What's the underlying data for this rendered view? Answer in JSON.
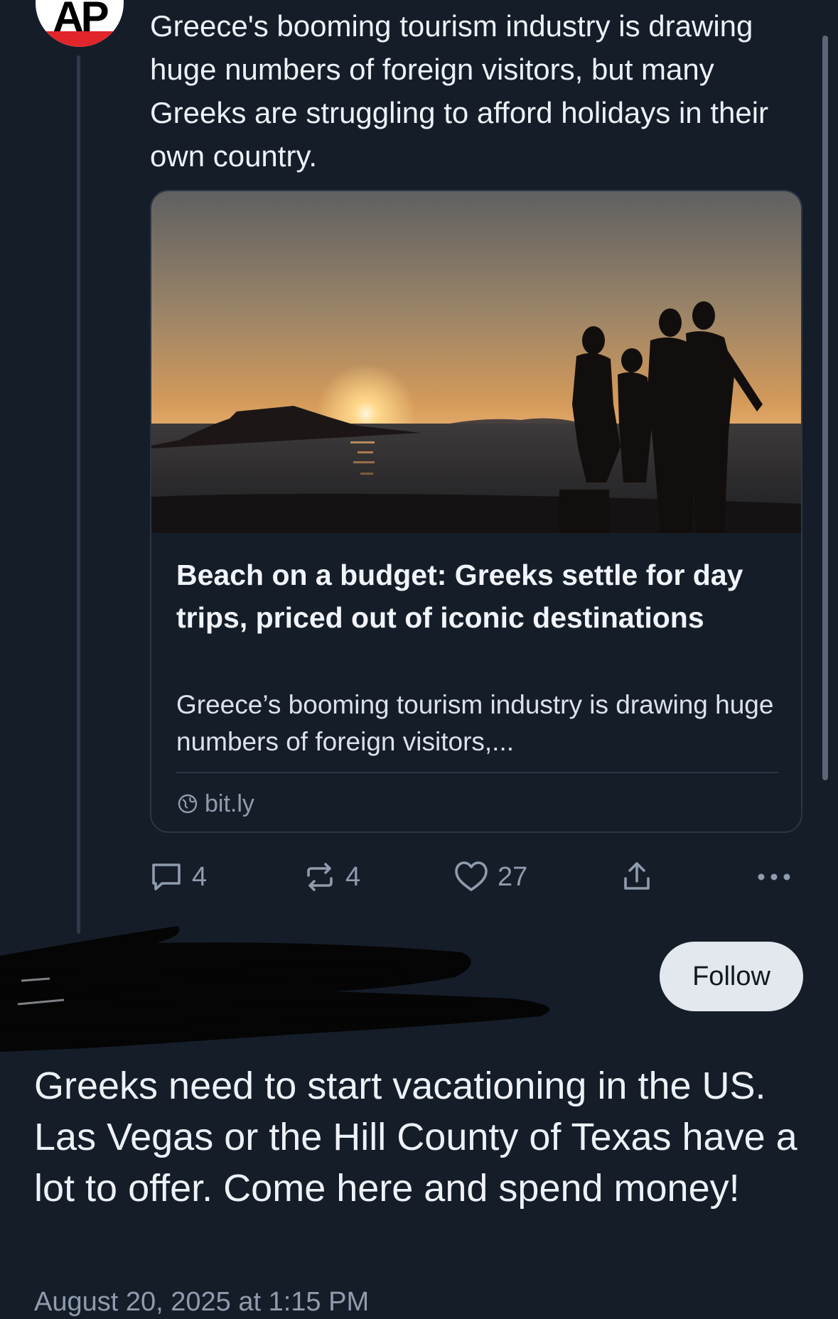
{
  "post": {
    "avatar_label": "AP",
    "text": "Greece's booming tourism industry is drawing huge numbers of foreign visitors, but many Greeks are struggling to afford holidays in their own country.",
    "link_card": {
      "title": "Beach on a budget: Greeks settle for day trips, priced out of iconic destinations",
      "description": "Greece’s booming tourism industry is drawing huge numbers of foreign visitors,...",
      "source": "bit.ly"
    },
    "actions": {
      "replies": "4",
      "reposts": "4",
      "likes": "27"
    }
  },
  "reply": {
    "follow_label": "Follow",
    "text": "Greeks need to start vacationing in the US. Las Vegas or the Hill County of Texas have a lot to offer. Come here and spend money!",
    "timestamp": "August 20, 2025 at 1:15 PM"
  },
  "colors": {
    "background": "#151d29",
    "text": "#eef2f6",
    "muted": "#8f9cae",
    "border": "#2b3646",
    "follow_bg": "#e3e8ee",
    "ap_red": "#e0262b"
  },
  "icons": [
    "comment-icon",
    "repost-icon",
    "heart-icon",
    "share-icon",
    "more-icon",
    "globe-icon"
  ]
}
